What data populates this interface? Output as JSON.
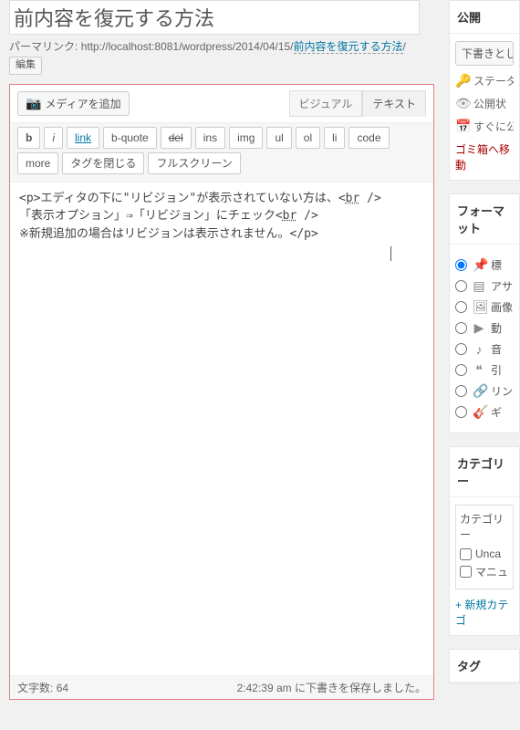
{
  "title": "前内容を復元する方法",
  "permalink": {
    "label": "パーマリンク:",
    "url_prefix": "http://localhost:8081/wordpress/2014/04/15/",
    "slug": "前内容を復元する方法",
    "edit": "編集"
  },
  "editor": {
    "media_button": "メディアを追加",
    "tabs": {
      "visual": "ビジュアル",
      "text": "テキスト"
    },
    "quicktags": {
      "b": "b",
      "i": "i",
      "link": "link",
      "bquote": "b-quote",
      "del": "del",
      "ins": "ins",
      "img": "img",
      "ul": "ul",
      "ol": "ol",
      "li": "li",
      "code": "code",
      "more": "more",
      "close": "タグを閉じる",
      "fullscreen": "フルスクリーン"
    },
    "content_lines": [
      "<p>エディタの下に\"リビジョン\"が表示されていない方は、<br />",
      "「表示オプション」⇒「リビジョン」にチェック<br />",
      "※新規追加の場合はリビジョンは表示されません。</p>"
    ],
    "word_count_label": "文字数:",
    "word_count": "64",
    "autosave": "2:42:39 am に下書きを保存しました。"
  },
  "sidebar": {
    "publish": {
      "title": "公開",
      "save_draft": "下書きとし",
      "status_label": "ステータ",
      "visibility_label": "公開状",
      "schedule_label": "すぐに公",
      "trash": "ゴミ箱へ移動"
    },
    "format": {
      "title": "フォーマット",
      "items": [
        {
          "icon": "📌",
          "label": "標"
        },
        {
          "icon": "▤",
          "label": "アサ"
        },
        {
          "icon": "🖼",
          "label": "画像"
        },
        {
          "icon": "▶",
          "label": "動"
        },
        {
          "icon": "♪",
          "label": "音"
        },
        {
          "icon": "❝",
          "label": "引"
        },
        {
          "icon": "🔗",
          "label": "リン"
        },
        {
          "icon": "🎸",
          "label": "ギ"
        }
      ]
    },
    "category": {
      "title": "カテゴリー",
      "tab": "カテゴリー",
      "items": [
        "Unca",
        "マニュ"
      ],
      "add_new": "+ 新規カテゴ"
    },
    "tags": {
      "title": "タグ"
    }
  }
}
